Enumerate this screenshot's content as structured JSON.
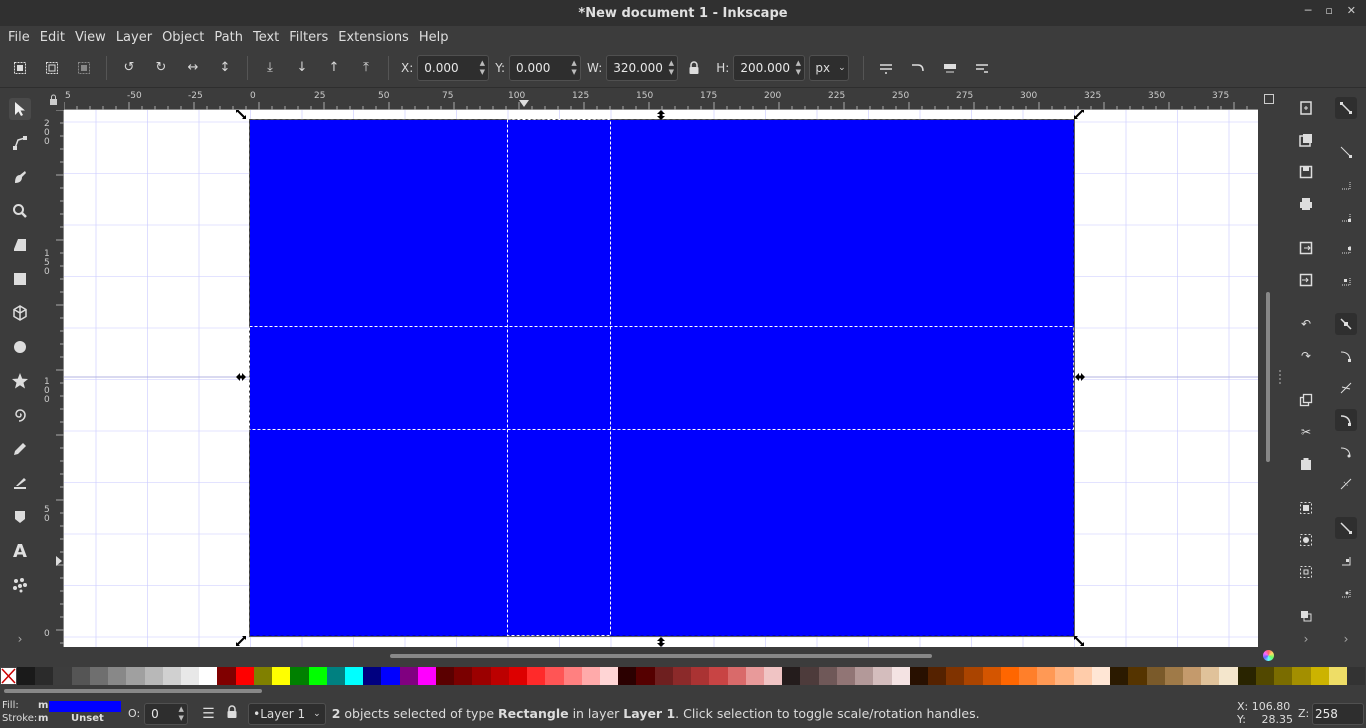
{
  "window": {
    "title": "*New document 1 - Inkscape",
    "min_glyph": "─",
    "restore_glyph": "▫",
    "close_glyph": "✕"
  },
  "menu": [
    "File",
    "Edit",
    "View",
    "Layer",
    "Object",
    "Path",
    "Text",
    "Filters",
    "Extensions",
    "Help"
  ],
  "toolbar": {
    "x_label": "X:",
    "x_value": "0.000",
    "y_label": "Y:",
    "y_value": "0.000",
    "w_label": "W:",
    "w_value": "320.000",
    "h_label": "H:",
    "h_value": "200.000",
    "unit": "px",
    "icons": [
      "select-all-icon",
      "select-all-layers-icon",
      "deselect-icon",
      "rotate-ccw-icon",
      "rotate-cw-icon",
      "flip-horizontal-icon",
      "flip-vertical-icon",
      "lower-to-bottom-icon",
      "lower-icon",
      "raise-icon",
      "raise-to-top-icon",
      "lock-ratio-icon"
    ]
  },
  "ruler": {
    "h_labels": [
      "5",
      "-50",
      "-25",
      "0",
      "25",
      "50",
      "75",
      "100",
      "125",
      "150",
      "175",
      "200",
      "225",
      "250",
      "275",
      "300",
      "325",
      "350",
      "375"
    ],
    "v_labels": [
      "200",
      "150",
      "100",
      "50",
      "0"
    ]
  },
  "canvas": {
    "rect_fill": "#0000ff",
    "guide_color": "#c8c8ff"
  },
  "tools": [
    "selector-tool-icon",
    "node-tool-icon",
    "tweak-tool-icon",
    "zoom-tool-icon",
    "measure-tool-icon",
    "rectangle-tool-icon",
    "box3d-tool-icon",
    "ellipse-tool-icon",
    "star-tool-icon",
    "spiral-tool-icon",
    "pencil-tool-icon",
    "pen-tool-icon",
    "calligraphy-tool-icon",
    "text-tool-icon",
    "spray-tool-icon"
  ],
  "palette": [
    "#1a1a1a",
    "#2b2b2b",
    "#3d3d3d",
    "#555",
    "#6f6f6f",
    "#888",
    "#a0a0a0",
    "#b8b8b8",
    "#d0d0d0",
    "#e8e8e8",
    "#fff",
    "#800000",
    "#ff0000",
    "#808000",
    "#ffff00",
    "#008000",
    "#00ff00",
    "#008080",
    "#00ffff",
    "#000080",
    "#0000ff",
    "#800080",
    "#ff00ff",
    "#5a0000",
    "#7a0000",
    "#9b0000",
    "#bc0000",
    "#dd0000",
    "#ff2a2a",
    "#ff5555",
    "#ff8080",
    "#ffaaaa",
    "#ffd5d5",
    "#2b0000",
    "#550000",
    "#6e1f1f",
    "#8b2a2a",
    "#aa3333",
    "#c84444",
    "#d96a6a",
    "#e89a9a",
    "#f0c4c4",
    "#241c1c",
    "#4d3b3b",
    "#6f5858",
    "#917575",
    "#b39999",
    "#d4bdbd",
    "#f4e3e3",
    "#281000",
    "#552200",
    "#803300",
    "#aa4400",
    "#d45500",
    "#ff6600",
    "#ff7f2a",
    "#ff9955",
    "#ffb380",
    "#ffccaa",
    "#ffe6d5",
    "#2b1a00",
    "#553400",
    "#7a5a2a",
    "#9f7a48",
    "#c49a6c",
    "#e0c29a",
    "#f4e6cc",
    "#292400",
    "#524800",
    "#7a6c00",
    "#a38f00",
    "#ccb300",
    "#eedd66",
    "#333"
  ],
  "status": {
    "fill_label": "Fill:",
    "fill_m": "m",
    "fill_color": "#0000ff",
    "stroke_label": "Stroke:",
    "stroke_m": "m",
    "stroke_value": "Unset",
    "o_label": "O:",
    "o_value": "0",
    "layer": "•Layer 1",
    "msg_count": "2",
    "msg_part1": " objects selected of type ",
    "msg_type": "Rectangle",
    "msg_part2": " in layer ",
    "msg_layer": "Layer 1",
    "msg_part3": ". Click selection to toggle scale/rotation handles.",
    "x_label": "X:",
    "x_value": "106.80",
    "y_label": "Y:",
    "y_value": "28.35",
    "z_label": "Z:",
    "z_value": "258"
  }
}
